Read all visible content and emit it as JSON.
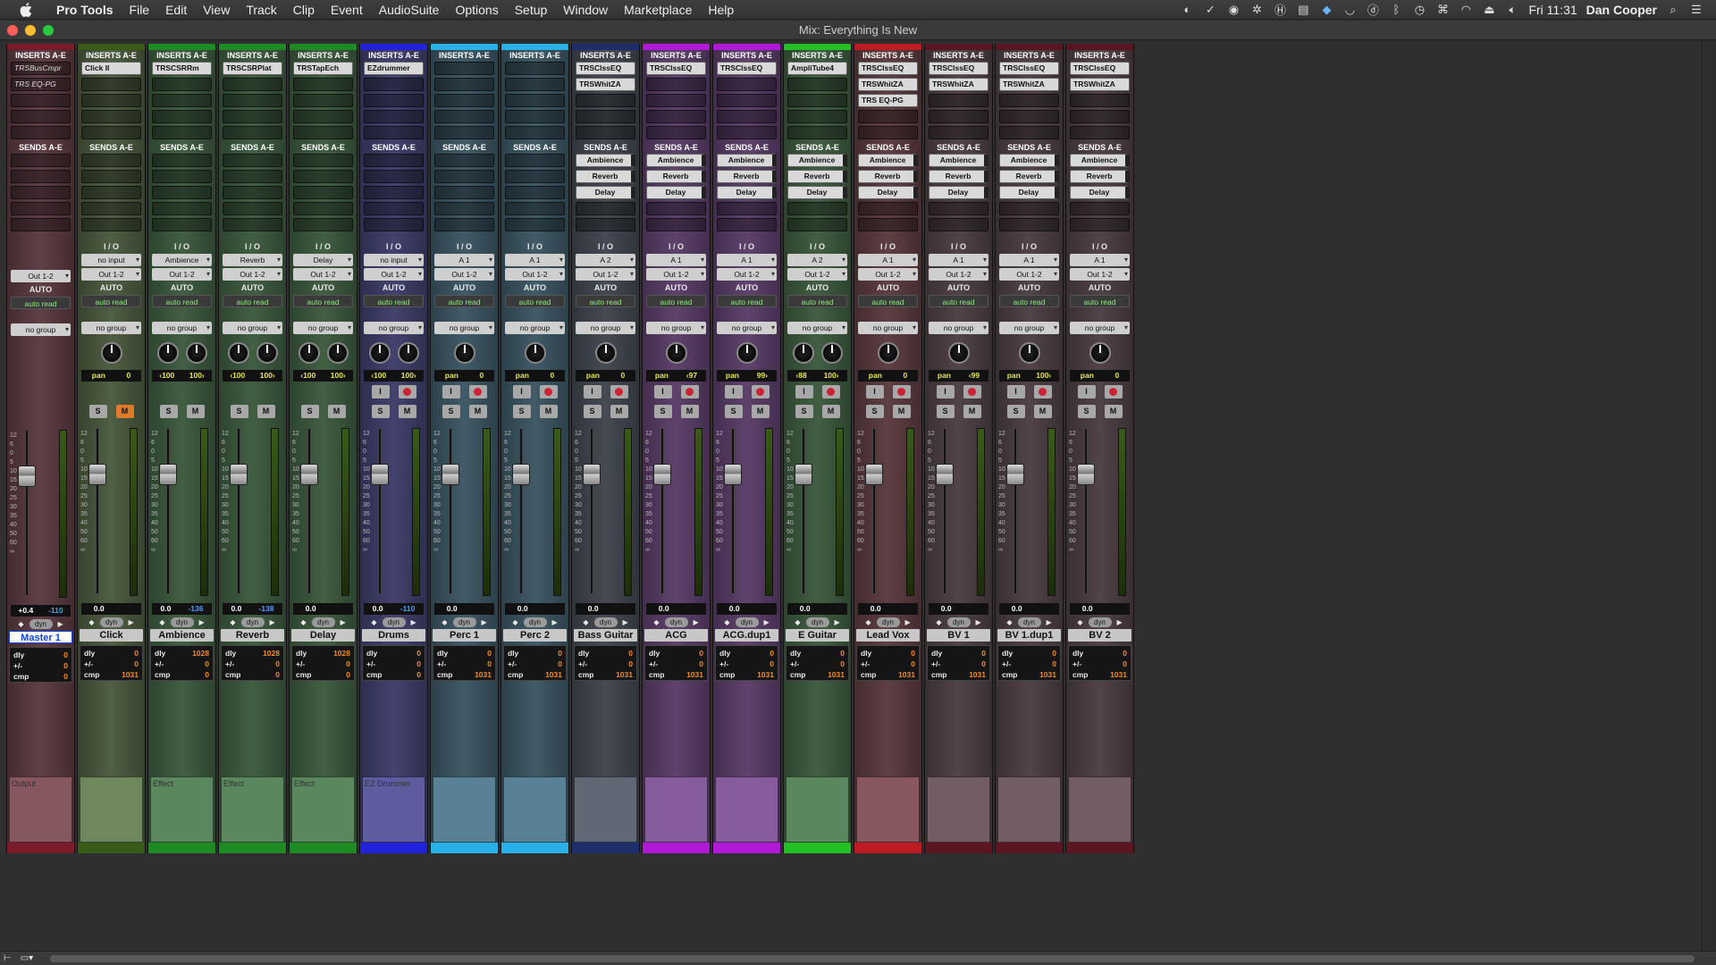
{
  "menubar": {
    "app_name": "Pro Tools",
    "menus": [
      "File",
      "Edit",
      "View",
      "Track",
      "Clip",
      "Event",
      "AudioSuite",
      "Options",
      "Setup",
      "Window",
      "Marketplace",
      "Help"
    ],
    "clock": "Fri 11:31",
    "user": "Dan Cooper"
  },
  "window": {
    "title": "Mix: Everything Is New"
  },
  "labels": {
    "inserts": "INSERTS A-E",
    "sends": "SENDS A-E",
    "io": "I / O",
    "auto": "AUTO",
    "dly": "dly",
    "plusminus": "+/-",
    "cmp": "cmp"
  },
  "strips": [
    {
      "name": "Master 1",
      "color": "#7a1b2a",
      "bg": "#5a3a40",
      "inserts": [
        "TRSBusCmpr",
        "TRS EQ-PG",
        "",
        "",
        ""
      ],
      "sends": [],
      "input": "",
      "output": "Out 1-2",
      "auto": "auto read",
      "group": "no group",
      "knobs": 0,
      "pan": [],
      "buttons": [],
      "vol": "+0.4",
      "peak": "-110",
      "dly": "0",
      "pm": "0",
      "cmp": "0",
      "comment": "Output",
      "selected": true
    },
    {
      "name": "Click",
      "color": "#3a5a1a",
      "bg": "#4a5a3e",
      "inserts": [
        "Click II",
        "",
        "",
        "",
        ""
      ],
      "sends": [],
      "input": "no input",
      "output": "Out 1-2",
      "auto": "auto read",
      "group": "no group",
      "knobs": 1,
      "pan": [
        "pan",
        "0"
      ],
      "buttons": [
        "S",
        "M"
      ],
      "vol": "0.0",
      "peak": "",
      "dly": "0",
      "pm": "0",
      "cmp": "1031",
      "comment": ""
    },
    {
      "name": "Ambience",
      "color": "#1e8a22",
      "bg": "#3c5a3e",
      "inserts": [
        "TRSCSRRm",
        "",
        "",
        "",
        ""
      ],
      "sends": [],
      "input": "Ambience",
      "output": "Out 1-2",
      "auto": "auto read",
      "group": "no group",
      "knobs": 2,
      "pan": [
        "‹100",
        "100›"
      ],
      "buttons": [
        "S",
        "M"
      ],
      "vol": "0.0",
      "peak": "-136",
      "dly": "1028",
      "pm": "0",
      "cmp": "0",
      "comment": "Effect"
    },
    {
      "name": "Reverb",
      "color": "#1e8a22",
      "bg": "#3c5a3e",
      "inserts": [
        "TRSCSRPlat",
        "",
        "",
        "",
        ""
      ],
      "sends": [],
      "input": "Reverb",
      "output": "Out 1-2",
      "auto": "auto read",
      "group": "no group",
      "knobs": 2,
      "pan": [
        "‹100",
        "100›"
      ],
      "buttons": [
        "S",
        "M"
      ],
      "vol": "0.0",
      "peak": "-138",
      "dly": "1028",
      "pm": "0",
      "cmp": "0",
      "comment": "Effect"
    },
    {
      "name": "Delay",
      "color": "#1e8a22",
      "bg": "#3c5a3e",
      "inserts": [
        "TRSTapEch",
        "",
        "",
        "",
        ""
      ],
      "sends": [],
      "input": "Delay",
      "output": "Out 1-2",
      "auto": "auto read",
      "group": "no group",
      "knobs": 2,
      "pan": [
        "‹100",
        "100›"
      ],
      "buttons": [
        "S",
        "M"
      ],
      "vol": "0.0",
      "peak": "",
      "dly": "1028",
      "pm": "0",
      "cmp": "0",
      "comment": "Effect"
    },
    {
      "name": "Drums",
      "color": "#2222dd",
      "bg": "#3d3d6a",
      "inserts": [
        "EZdrummer",
        "",
        "",
        "",
        ""
      ],
      "sends": [],
      "input": "no input",
      "output": "Out 1-2",
      "auto": "auto read",
      "group": "no group",
      "knobs": 2,
      "pan": [
        "‹100",
        "100›"
      ],
      "buttons": [
        "S",
        "M"
      ],
      "vol": "0.0",
      "peak": "-110",
      "dly": "0",
      "pm": "0",
      "cmp": "0",
      "comment": "EZ Drummer"
    },
    {
      "name": "Perc 1",
      "color": "#2ab0e8",
      "bg": "#3b5663",
      "inserts": [
        "",
        "",
        "",
        "",
        ""
      ],
      "sends": [],
      "input": "A 1",
      "output": "Out 1-2",
      "auto": "auto read",
      "group": "no group",
      "knobs": 1,
      "pan": [
        "pan",
        "0"
      ],
      "buttons": [
        "S",
        "M"
      ],
      "vol": "0.0",
      "peak": "",
      "dly": "0",
      "pm": "0",
      "cmp": "1031",
      "comment": ""
    },
    {
      "name": "Perc 2",
      "color": "#2ab0e8",
      "bg": "#3b5663",
      "inserts": [
        "",
        "",
        "",
        "",
        ""
      ],
      "sends": [],
      "input": "A 1",
      "output": "Out 1-2",
      "auto": "auto read",
      "group": "no group",
      "knobs": 1,
      "pan": [
        "pan",
        "0"
      ],
      "buttons": [
        "S",
        "M"
      ],
      "vol": "0.0",
      "peak": "",
      "dly": "0",
      "pm": "0",
      "cmp": "1031",
      "comment": ""
    },
    {
      "name": "Bass Guitar",
      "color": "#1d2e6a",
      "bg": "#40454e",
      "inserts": [
        "TRSClssEQ",
        "TRSWhitZA",
        "",
        "",
        ""
      ],
      "sends": [
        "Ambience",
        "Reverb",
        "Delay"
      ],
      "input": "A 2",
      "output": "Out 1-2",
      "auto": "auto read",
      "group": "no group",
      "knobs": 1,
      "pan": [
        "pan",
        "0"
      ],
      "buttons": [
        "S",
        "M"
      ],
      "vol": "0.0",
      "peak": "",
      "dly": "0",
      "pm": "0",
      "cmp": "1031",
      "comment": ""
    },
    {
      "name": "ACG",
      "color": "#b01ad6",
      "bg": "#5a3d68",
      "inserts": [
        "TRSClssEQ",
        "",
        "",
        "",
        ""
      ],
      "sends": [
        "Ambience",
        "Reverb",
        "Delay"
      ],
      "input": "A 1",
      "output": "Out 1-2",
      "auto": "auto read",
      "group": "no group",
      "knobs": 1,
      "pan": [
        "pan",
        "‹97"
      ],
      "buttons": [
        "S",
        "M"
      ],
      "vol": "0.0",
      "peak": "",
      "dly": "0",
      "pm": "0",
      "cmp": "1031",
      "comment": ""
    },
    {
      "name": "ACG.dup1",
      "color": "#b01ad6",
      "bg": "#5a3d68",
      "inserts": [
        "TRSClssEQ",
        "",
        "",
        "",
        ""
      ],
      "sends": [
        "Ambience",
        "Reverb",
        "Delay"
      ],
      "input": "A 1",
      "output": "Out 1-2",
      "auto": "auto read",
      "group": "no group",
      "knobs": 1,
      "pan": [
        "pan",
        "99›"
      ],
      "buttons": [
        "S",
        "M"
      ],
      "vol": "0.0",
      "peak": "",
      "dly": "0",
      "pm": "0",
      "cmp": "1031",
      "comment": ""
    },
    {
      "name": "E Guitar",
      "color": "#22c022",
      "bg": "#3c5a3e",
      "inserts": [
        "AmpliTube4",
        "",
        "",
        "",
        ""
      ],
      "sends": [
        "Ambience",
        "Reverb",
        "Delay"
      ],
      "input": "A 2",
      "output": "Out 1-2",
      "auto": "auto read",
      "group": "no group",
      "knobs": 2,
      "pan": [
        "‹88",
        "100›"
      ],
      "buttons": [
        "S",
        "M"
      ],
      "vol": "0.0",
      "peak": "",
      "dly": "0",
      "pm": "0",
      "cmp": "1031",
      "comment": ""
    },
    {
      "name": "Lead Vox",
      "color": "#c01a22",
      "bg": "#5a3a3e",
      "inserts": [
        "TRSClssEQ",
        "TRSWhitZA",
        "TRS EQ-PG",
        "",
        ""
      ],
      "sends": [
        "Ambience",
        "Reverb",
        "Delay"
      ],
      "input": "A 1",
      "output": "Out 1-2",
      "auto": "auto read",
      "group": "no group",
      "knobs": 1,
      "pan": [
        "pan",
        "0"
      ],
      "buttons": [
        "S",
        "M"
      ],
      "vol": "0.0",
      "peak": "",
      "dly": "0",
      "pm": "0",
      "cmp": "1031",
      "comment": ""
    },
    {
      "name": "BV 1",
      "color": "#5a1520",
      "bg": "#4c3e42",
      "inserts": [
        "TRSClssEQ",
        "TRSWhitZA",
        "",
        "",
        ""
      ],
      "sends": [
        "Ambience",
        "Reverb",
        "Delay"
      ],
      "input": "A 1",
      "output": "Out 1-2",
      "auto": "auto read",
      "group": "no group",
      "knobs": 1,
      "pan": [
        "pan",
        "‹99"
      ],
      "buttons": [
        "S",
        "M"
      ],
      "vol": "0.0",
      "peak": "",
      "dly": "0",
      "pm": "0",
      "cmp": "1031",
      "comment": ""
    },
    {
      "name": "BV 1.dup1",
      "color": "#5a1520",
      "bg": "#4c3e42",
      "inserts": [
        "TRSClssEQ",
        "TRSWhitZA",
        "",
        "",
        ""
      ],
      "sends": [
        "Ambience",
        "Reverb",
        "Delay"
      ],
      "input": "A 1",
      "output": "Out 1-2",
      "auto": "auto read",
      "group": "no group",
      "knobs": 1,
      "pan": [
        "pan",
        "100›"
      ],
      "buttons": [
        "S",
        "M"
      ],
      "vol": "0.0",
      "peak": "",
      "dly": "0",
      "pm": "0",
      "cmp": "1031",
      "comment": ""
    },
    {
      "name": "BV 2",
      "color": "#5a1520",
      "bg": "#4c3e42",
      "inserts": [
        "TRSClssEQ",
        "TRSWhitZA",
        "",
        "",
        ""
      ],
      "sends": [
        "Ambience",
        "Reverb",
        "Delay"
      ],
      "input": "A 1",
      "output": "Out 1-2",
      "auto": "auto read",
      "group": "no group",
      "knobs": 1,
      "pan": [
        "pan",
        "0"
      ],
      "buttons": [
        "S",
        "M"
      ],
      "vol": "0.0",
      "peak": "",
      "dly": "0",
      "pm": "0",
      "cmp": "1031",
      "comment": ""
    }
  ]
}
